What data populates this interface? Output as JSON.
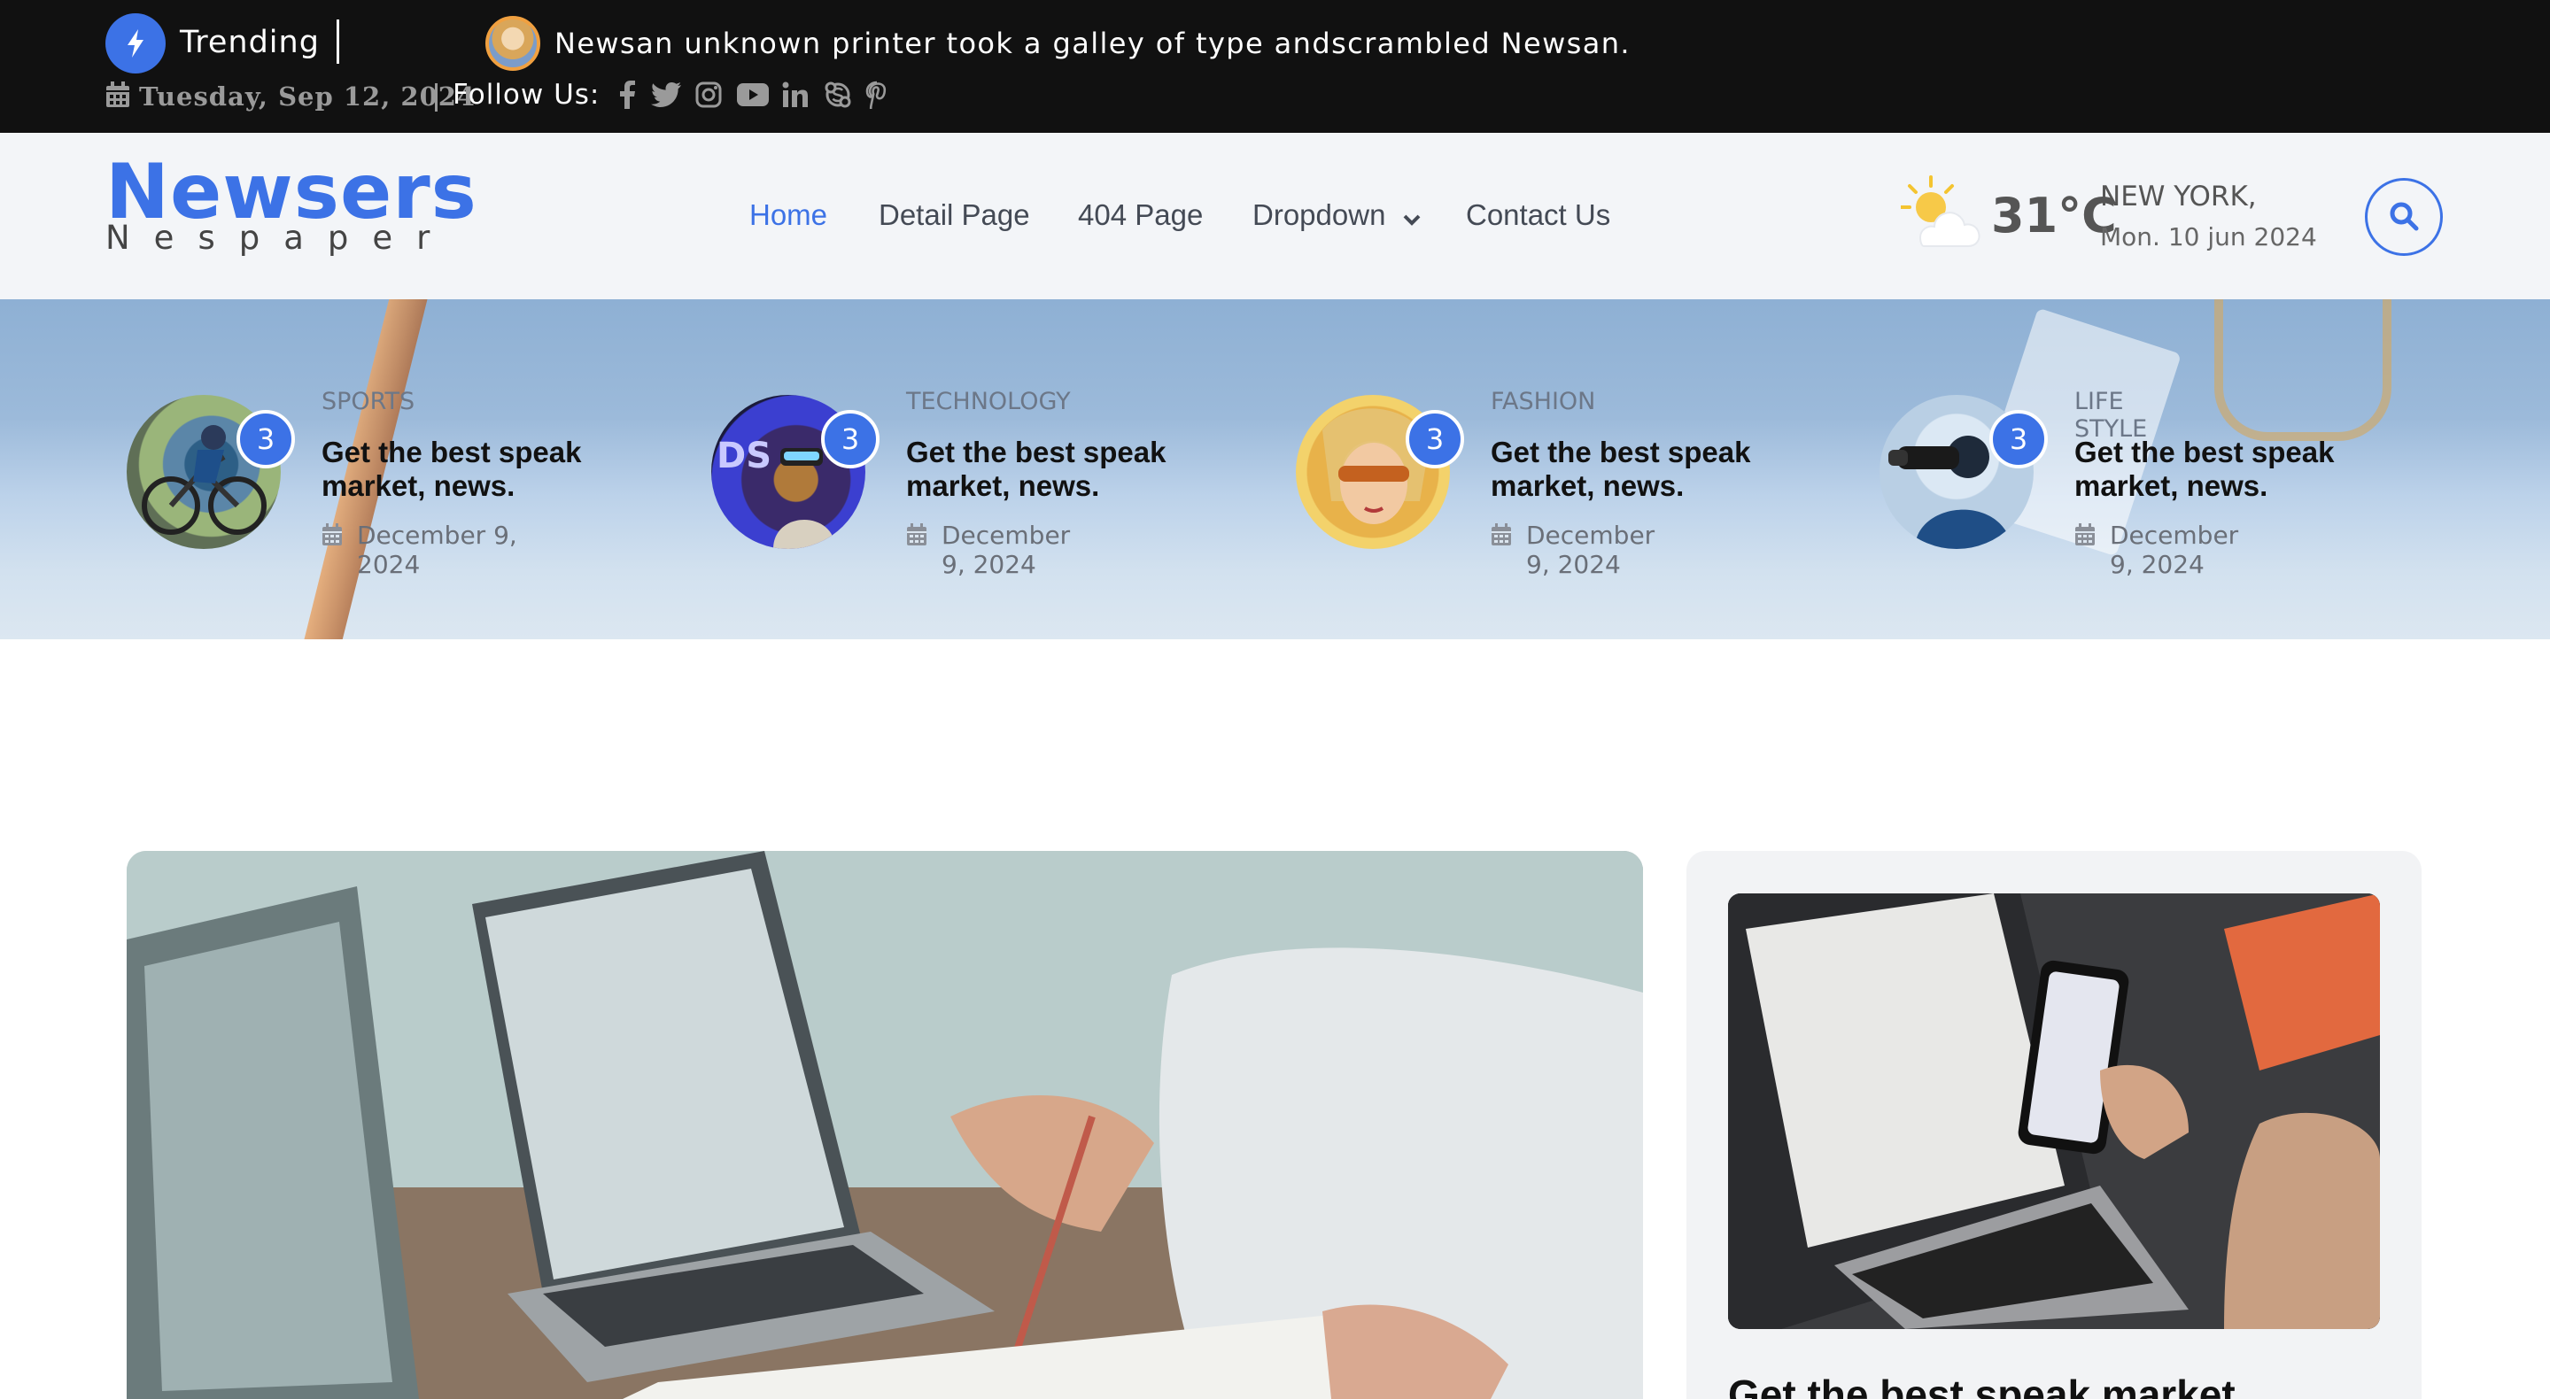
{
  "colors": {
    "accent": "#3c72e6",
    "topbar_bg": "#111111",
    "header_bg": "#f3f5f8",
    "side_card_bg": "#f2f3f5"
  },
  "topbar": {
    "trending_icon": "bolt-icon",
    "trending_label": "Trending",
    "headline": "Newsan unknown printer took a galley of type andscrambled Newsan.",
    "date_icon": "calendar-icon",
    "date": "Tuesday, Sep 12, 2024",
    "follow_label": "Follow Us:",
    "social_icons": [
      "facebook-icon",
      "twitter-icon",
      "instagram-icon",
      "youtube-icon",
      "linkedin-icon",
      "skype-icon",
      "pinterest-icon"
    ]
  },
  "header": {
    "logo_main": "Newsers",
    "logo_sub": "Nespaper",
    "nav": [
      {
        "label": "Home",
        "active": true
      },
      {
        "label": "Detail Page"
      },
      {
        "label": "404 Page"
      },
      {
        "label": "Dropdown",
        "icon": "chevron-down-icon"
      },
      {
        "label": "Contact Us"
      }
    ],
    "weather": {
      "icon": "partly-cloudy-icon",
      "temperature": "31°C",
      "city": "NEW YORK,",
      "date": "Mon. 10 jun 2024"
    },
    "search_icon": "search-icon"
  },
  "banner": {
    "stories": [
      {
        "badge": "3",
        "category": "SPORTS",
        "title": "Get the best speak market, news.",
        "date": "December 9, 2024"
      },
      {
        "badge": "3",
        "category": "TECHNOLOGY",
        "title": "Get the best speak market, news.",
        "date": "December 9, 2024"
      },
      {
        "badge": "3",
        "category": "FASHION",
        "title": "Get the best speak market, news.",
        "date": "December 9, 2024"
      },
      {
        "badge": "3",
        "category": "LIFE STYLE",
        "title": "Get the best speak market, news.",
        "date": "December 9, 2024"
      }
    ]
  },
  "main": {
    "side_card": {
      "title": "Get the best speak market"
    }
  }
}
